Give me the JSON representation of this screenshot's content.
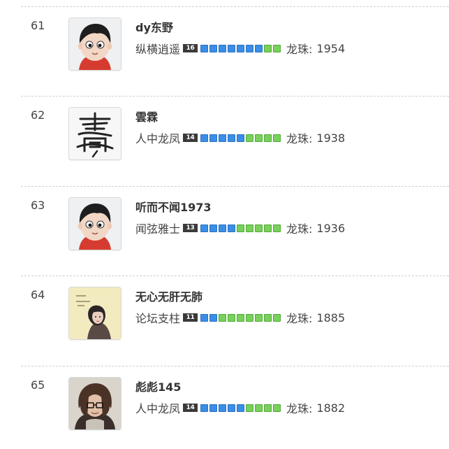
{
  "colors": {
    "level_bg": "#3a3a3a",
    "block_blue": "#3a8ee6",
    "block_green": "#79d05b",
    "divider": "#cfcfcf"
  },
  "entries": [
    {
      "rank": "61",
      "name": "dy东野",
      "title": "纵横逍遥",
      "level": "16",
      "blocks": [
        "blue",
        "blue",
        "blue",
        "blue",
        "blue",
        "blue",
        "blue",
        "green",
        "green"
      ],
      "pearls_label": "龙珠:",
      "pearls": "1954",
      "avatar": "cartoon-boy-avatar"
    },
    {
      "rank": "62",
      "name": "雲霖",
      "title": "人中龙凤",
      "level": "14",
      "blocks": [
        "blue",
        "blue",
        "blue",
        "blue",
        "blue",
        "green",
        "green",
        "green",
        "green"
      ],
      "pearls_label": "龙珠:",
      "pearls": "1938",
      "avatar": "calligraphy-avatar"
    },
    {
      "rank": "63",
      "name": "听而不闻1973",
      "title": "闻弦雅士",
      "level": "13",
      "blocks": [
        "blue",
        "blue",
        "blue",
        "blue",
        "green",
        "green",
        "green",
        "green",
        "green"
      ],
      "pearls_label": "龙珠:",
      "pearls": "1936",
      "avatar": "cartoon-boy-avatar"
    },
    {
      "rank": "64",
      "name": "无心无肝无肺",
      "title": "论坛支柱",
      "level": "11",
      "blocks": [
        "blue",
        "blue",
        "green",
        "green",
        "green",
        "green",
        "green",
        "green",
        "green"
      ],
      "pearls_label": "龙珠:",
      "pearls": "1885",
      "avatar": "woman-photo-avatar"
    },
    {
      "rank": "65",
      "name": "彪彪145",
      "title": "人中龙凤",
      "level": "14",
      "blocks": [
        "blue",
        "blue",
        "blue",
        "blue",
        "blue",
        "green",
        "green",
        "green",
        "green"
      ],
      "pearls_label": "龙珠:",
      "pearls": "1882",
      "avatar": "man-glasses-avatar"
    }
  ]
}
